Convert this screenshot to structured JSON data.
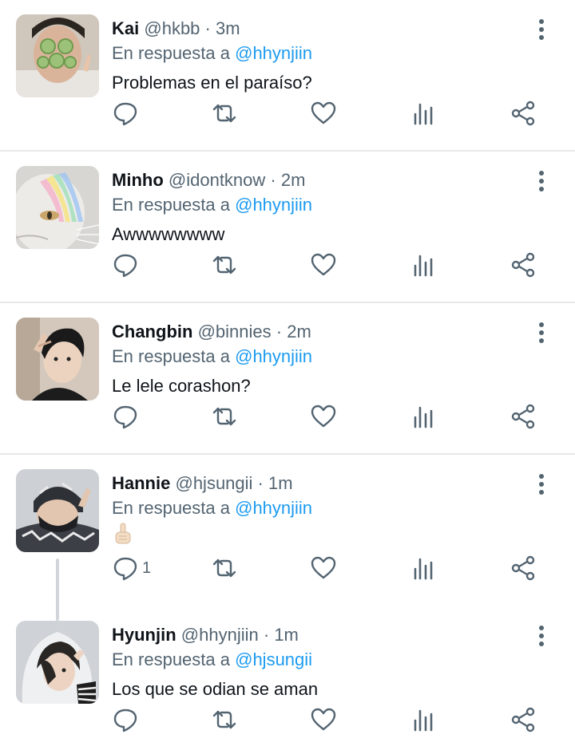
{
  "icons": {
    "reply": "speech-bubble-icon",
    "retweet": "retweet-arrows-icon",
    "like": "heart-icon",
    "analytics": "bar-chart-icon",
    "share": "share-nodes-icon",
    "more": "vertical-ellipsis-icon"
  },
  "colors": {
    "mention": "#1d9bf0",
    "secondary_text": "#536471",
    "primary_text": "#0f1419",
    "divider": "#e6e8ea",
    "thread_line": "#d2d6da"
  },
  "tweets": [
    {
      "name": "Kai",
      "handle": "@hkbb",
      "separator": "·",
      "time": "3m",
      "reply_prefix": "En respuesta a",
      "reply_to": "@hhynjiin",
      "text": "Problemas en el paraíso?",
      "reply_count": ""
    },
    {
      "name": "Minho",
      "handle": "@idontknow",
      "separator": "·",
      "time": "2m",
      "reply_prefix": "En respuesta a",
      "reply_to": "@hhynjiin",
      "text": "Awwwwwwww",
      "reply_count": ""
    },
    {
      "name": "Changbin",
      "handle": "@binnies",
      "separator": "·",
      "time": "2m",
      "reply_prefix": "En respuesta a",
      "reply_to": "@hhynjiin",
      "text": "Le lele corashon?",
      "reply_count": ""
    },
    {
      "name": "Hannie",
      "handle": "@hjsungii",
      "separator": "·",
      "time": "1m",
      "reply_prefix": "En respuesta a",
      "reply_to": "@hhynjiin",
      "text": "",
      "emoji": "pointing-up-hand-emoji",
      "reply_count": "1"
    },
    {
      "name": "Hyunjin",
      "handle": "@hhynjiin",
      "separator": "·",
      "time": "1m",
      "reply_prefix": "En respuesta a",
      "reply_to": "@hjsungii",
      "text": "Los que se odian se aman",
      "reply_count": ""
    }
  ]
}
